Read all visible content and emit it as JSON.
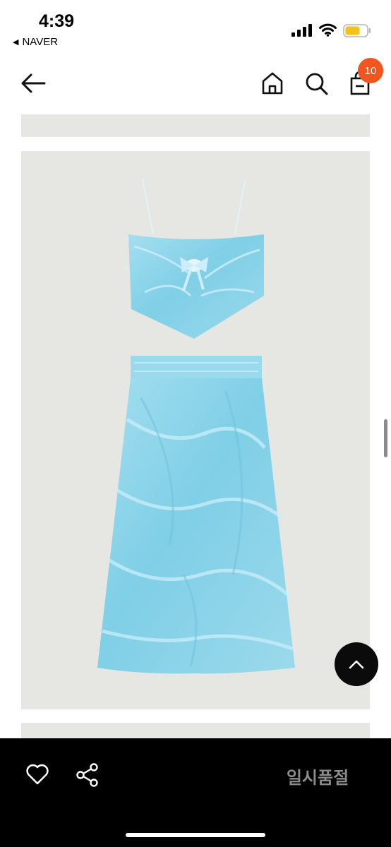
{
  "status_bar": {
    "time": "4:39",
    "back_app": "NAVER",
    "back_glyph": "◀"
  },
  "header": {
    "cart_count": "10",
    "icons": [
      "arrow-left-icon",
      "home-icon",
      "search-icon",
      "shopping-bag-icon"
    ]
  },
  "bottom_bar": {
    "status_label": "일시품절",
    "icons": [
      "heart-icon",
      "share-icon"
    ]
  },
  "colors": {
    "badge": "#f3551f",
    "tile_background": "#e6e6e2",
    "garment": "#8fd3e8",
    "bottom_bar": "#000000",
    "status_label": "#8c8c8c"
  }
}
